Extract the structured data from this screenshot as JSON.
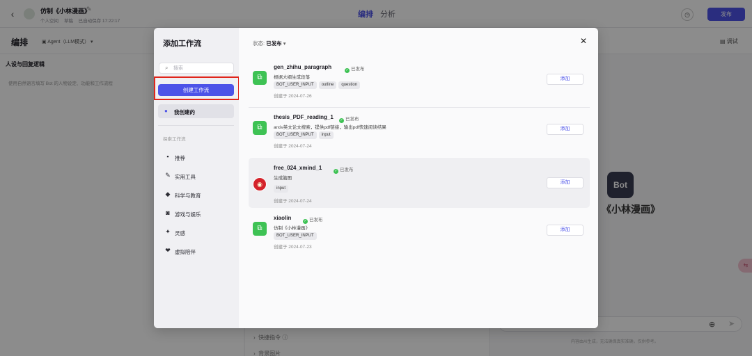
{
  "header": {
    "bot_title": "仿制《小林漫画》",
    "space": "个人空间",
    "draft": "草稿",
    "autosave": "已自动保存 17:22:17",
    "tab_active": "编排",
    "tab_inactive": "分析",
    "publish": "发布"
  },
  "subbar": {
    "title": "编排",
    "mode": "Agent（LLM模式）",
    "debug": "调试"
  },
  "left": {
    "heading": "人设与回复逻辑",
    "desc": "使用自然语言填写 Bot 的人物设定、功能和工作流程"
  },
  "mid": {
    "shortcut": "快捷指令",
    "background": "背景图片"
  },
  "preview": {
    "avatar_text": "Bot",
    "name": "《小林漫画》",
    "disclaimer": "内容由AI生成，无法确保真实准确，仅供参考。",
    "float_badge": "⇆"
  },
  "modal": {
    "title": "添加工作流",
    "search_placeholder": "搜索",
    "create_button": "创建工作流",
    "my_created": "我创建的",
    "explore_label": "探索工作流",
    "categories": [
      {
        "label": "推荐",
        "icon": "grid-icon"
      },
      {
        "label": "实用工具",
        "icon": "wrench-icon"
      },
      {
        "label": "科学与教育",
        "icon": "graduation-cap-icon"
      },
      {
        "label": "游戏与娱乐",
        "icon": "gamepad-icon"
      },
      {
        "label": "灵感",
        "icon": "lightbulb-icon"
      },
      {
        "label": "虚拟陪伴",
        "icon": "companion-icon"
      }
    ],
    "status_label": "状态:",
    "status_value": "已发布",
    "add_label": "添加",
    "published_label": "已发布",
    "workflows": [
      {
        "name": "gen_zhihu_paragraph",
        "desc": "根据大纲生成段落",
        "tags": [
          "BOT_USER_INPUT",
          "outline",
          "question"
        ],
        "date": "创建于 2024-07-26",
        "icon": "workflow-icon"
      },
      {
        "name": "thesis_PDF_reading_1",
        "desc": "arxiv英文论文搜索，提供pdf链接，输出pdf快速阅读结果",
        "tags": [
          "BOT_USER_INPUT",
          "input"
        ],
        "date": "创建于 2024-07-24",
        "icon": "workflow-icon"
      },
      {
        "name": "free_024_xmind_1",
        "desc": "生成脑图",
        "tags": [
          "input"
        ],
        "date": "创建于 2024-07-24",
        "icon": "avatar-icon"
      },
      {
        "name": "xiaolin",
        "desc": "仿制《小林漫画》",
        "tags": [
          "BOT_USER_INPUT"
        ],
        "date": "创建于 2024-07-23",
        "icon": "workflow-icon"
      }
    ]
  },
  "colors": {
    "accent": "#4d53e8",
    "published_green": "#3ec254",
    "highlight_red": "#e0251b"
  }
}
